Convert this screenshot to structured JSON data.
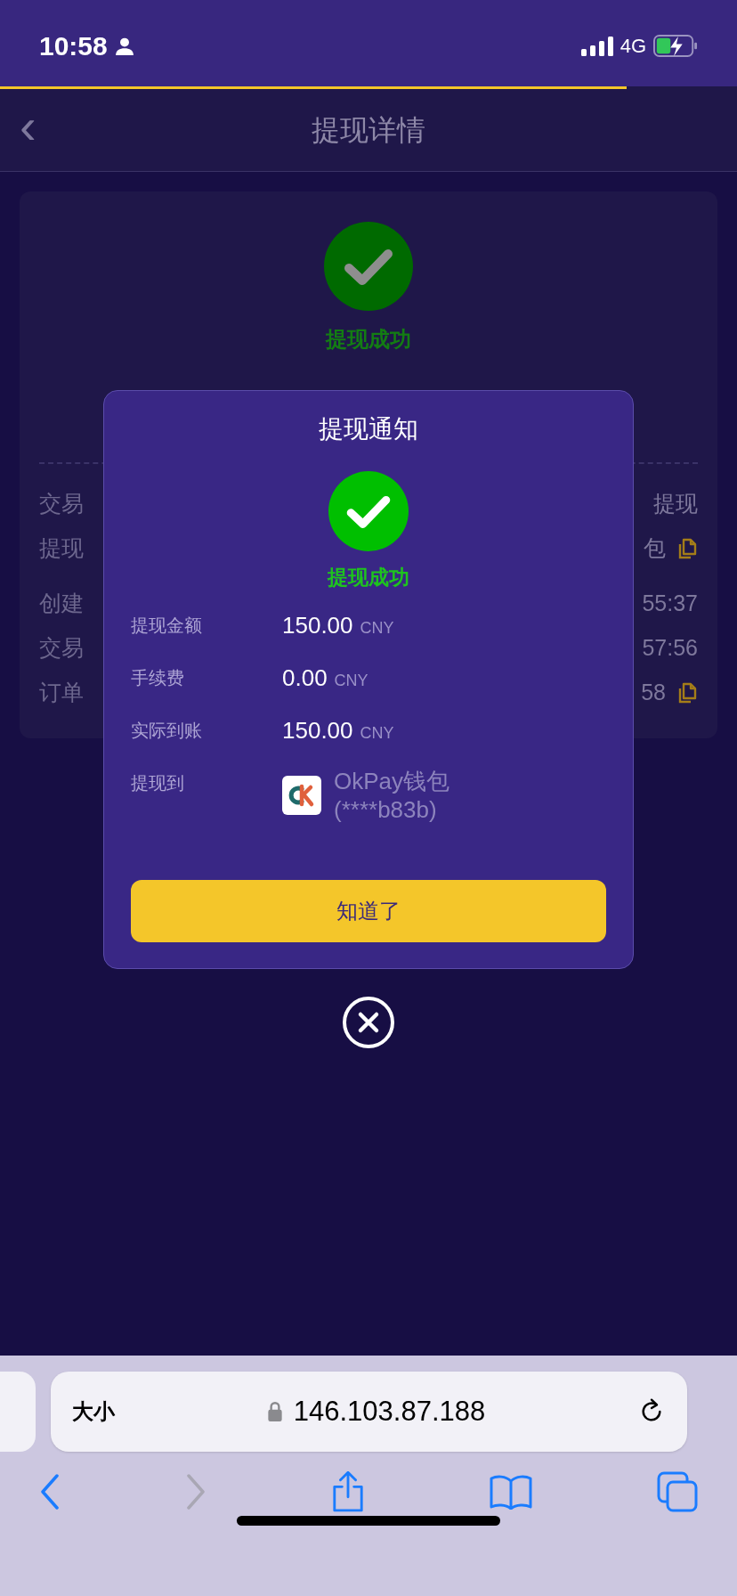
{
  "status_bar": {
    "time": "10:58",
    "network": "4G"
  },
  "load_progress": {
    "level": 0.85
  },
  "nav": {
    "back": "‹",
    "title": "提现详情"
  },
  "detail_card": {
    "status": "提现成功",
    "rows": [
      {
        "label": "交易",
        "value": "提现",
        "copy": false
      },
      {
        "label": "提现",
        "value": "包",
        "copy": true
      },
      {
        "label": "创建",
        "value": "55:37",
        "copy": false
      },
      {
        "label": "交易",
        "value": "57:56",
        "copy": false
      },
      {
        "label": "订单",
        "value": "58",
        "copy": true
      }
    ]
  },
  "dialog": {
    "title": "提现通知",
    "status": "提现成功",
    "rows": [
      {
        "kind": "amount",
        "label": "提现金额",
        "value": "150.00",
        "unit": "CNY"
      },
      {
        "kind": "amount",
        "label": "手续费",
        "value": "0.00",
        "unit": "CNY"
      },
      {
        "kind": "amount",
        "label": "实际到账",
        "value": "150.00",
        "unit": "CNY"
      },
      {
        "kind": "wallet",
        "label": "提现到",
        "name": "OkPay钱包",
        "account": "(****b83b)"
      }
    ],
    "button": "知道了"
  },
  "browser": {
    "text_size": "大小",
    "url": "146.103.87.188",
    "back_disabled": false,
    "forward_disabled": true
  }
}
